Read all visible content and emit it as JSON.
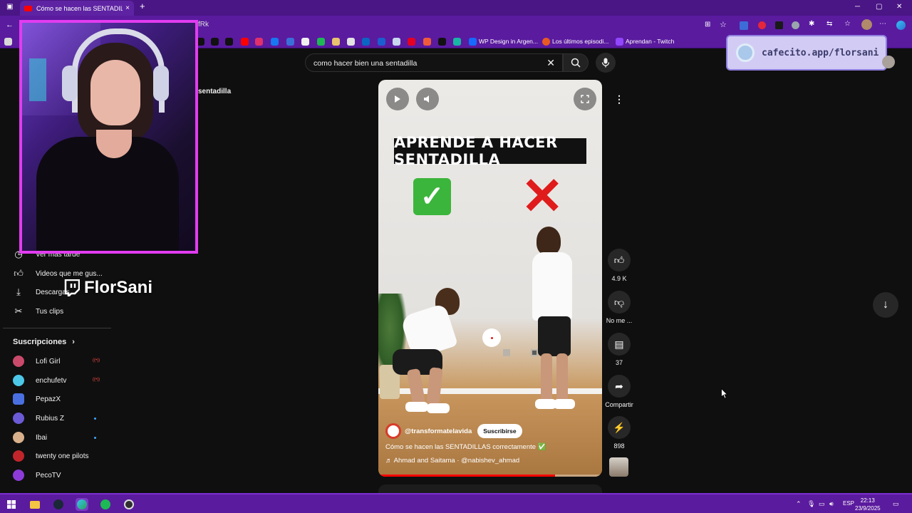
{
  "browser": {
    "tab_title": "Cómo se hacen las SENTADILLAS",
    "tab_close": "×",
    "new_tab": "+",
    "url_fragment": "fRk",
    "bookmarks": [
      {
        "label": "WP Design in Argen..."
      },
      {
        "label": "Los últimos episodi..."
      },
      {
        "label": "Aprendan - Twitch"
      }
    ]
  },
  "sidebar": {
    "items": [
      {
        "label": "Ver más tarde",
        "icon": "clock-icon"
      },
      {
        "label": "Videos que me gus...",
        "icon": "thumbs-up-icon"
      },
      {
        "label": "Descargas",
        "icon": "download-icon"
      },
      {
        "label": "Tus clips",
        "icon": "scissors-icon"
      }
    ],
    "subscriptions_heading": "Suscripciones",
    "subscriptions": [
      {
        "name": "Lofi Girl",
        "status": "live",
        "color": "#c94a6a"
      },
      {
        "name": "enchufetv",
        "status": "live",
        "color": "#4cc7e8"
      },
      {
        "name": "PepazX",
        "status": "",
        "color": "#4a6fe0"
      },
      {
        "name": "Rubius Z",
        "status": "new",
        "color": "#6b5bd6"
      },
      {
        "name": "Ibai",
        "status": "new",
        "color": "#d9b08c"
      },
      {
        "name": "twenty one pilots",
        "status": "",
        "color": "#c0252b"
      },
      {
        "name": "PecoTV",
        "status": "",
        "color": "#8d3bd8"
      }
    ],
    "partial_label": "sentadilla"
  },
  "search": {
    "query": "como hacer bien una sentadilla"
  },
  "video": {
    "overlay_title": "APRENDE A HACER SENTADILLA",
    "channel": "@transformatelavida",
    "subscribe_label": "Suscribirse",
    "description": "Cómo se hacen las SENTADILLAS correctamente ✅",
    "music": "♬ Ahmad and Saitama · @nabishev_ahmad",
    "progress": 0.79
  },
  "actions": {
    "likes": "4.9 K",
    "dislike_label": "No me ...",
    "comments": "37",
    "share_label": "Compartir",
    "remix": "898"
  },
  "overlays": {
    "cafecito": "cafecito.app/florsani",
    "twitch_name": "FlorSani"
  },
  "taskbar": {
    "lang": "ESP",
    "time": "22:13",
    "date": "23/9/2025"
  },
  "colors": {
    "accent": "#e23cf0",
    "browser_purple": "#5a1b9f",
    "youtube_red": "#ff0000"
  }
}
